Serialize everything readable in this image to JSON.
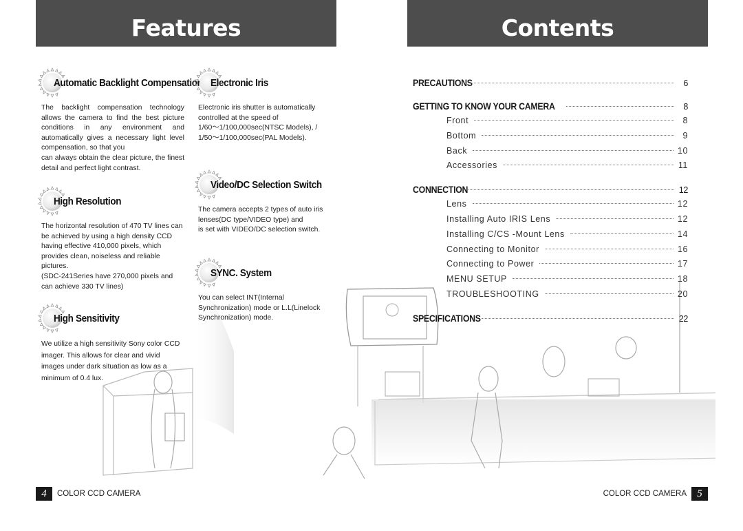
{
  "left_page": {
    "title": "Features",
    "features": [
      {
        "title": "Automatic Backlight Compensation",
        "body": [
          "The backlight compensation technology allows the camera to find the best picture conditions in any environment and automatically gives a necessary light level compensation, so that you",
          "can always obtain the clear picture, the finest detail and perfect light contrast."
        ]
      },
      {
        "title": "Electronic Iris",
        "body": [
          "Electronic iris shutter is automatically controlled at the speed of",
          "1/60～1/100,000sec(NTSC Models), /",
          "1/50～1/100,000sec(PAL Models)."
        ]
      },
      {
        "title": "High Resolution",
        "body": [
          "The horizontal resolution of 470 TV lines can be achieved by using a high density CCD having effective 410,000 pixels, which provides clean, noiseless and reliable pictures.",
          "(SDC-241Series  have 270,000 pixels and can achieve 330 TV lines)"
        ]
      },
      {
        "title": "Video/DC Selection Switch",
        "body": [
          "The camera accepts 2 types of auto iris lenses(DC type/VIDEO type) and",
          "is set with VIDEO/DC selection switch."
        ]
      },
      {
        "title": "SYNC. System",
        "body": [
          "You can select INT(Internal",
          "Synchronization) mode or L.L(Linelock",
          "Synchronization) mode."
        ]
      },
      {
        "title": "High Sensitivity",
        "body": [
          "We utilize a high sensitivity Sony color CCD imager. This allows for clear and vivid images under dark situation as low as a minimum of 0.4 lux."
        ]
      }
    ],
    "footer": {
      "page_number": "4",
      "label": "COLOR CCD CAMERA"
    }
  },
  "right_page": {
    "title": "Contents",
    "toc": [
      {
        "level": "main",
        "label": "PRECAUTIONS",
        "page": "6"
      },
      {
        "level": "main",
        "label": "GETTING TO KNOW YOUR CAMERA",
        "page": "8"
      },
      {
        "level": "sub",
        "label": "Front",
        "page": "8"
      },
      {
        "level": "sub",
        "label": "Bottom",
        "page": "9"
      },
      {
        "level": "sub",
        "label": "Back",
        "page": "10"
      },
      {
        "level": "sub",
        "label": "Accessories",
        "page": "11"
      },
      {
        "level": "main",
        "label": "CONNECTION",
        "page": "12"
      },
      {
        "level": "sub",
        "label": "Lens",
        "page": "12"
      },
      {
        "level": "sub",
        "label": "Installing Auto IRIS Lens",
        "page": "12"
      },
      {
        "level": "sub",
        "label": "Installing C/CS -Mount Lens",
        "page": "14"
      },
      {
        "level": "sub",
        "label": "Connecting to Monitor",
        "page": "16"
      },
      {
        "level": "sub",
        "label": "Connecting to Power",
        "page": "17"
      },
      {
        "level": "sub",
        "label": "MENU SETUP",
        "page": "18"
      },
      {
        "level": "sub",
        "label": "TROUBLESHOOTING",
        "page": "20"
      },
      {
        "level": "main",
        "label": "SPECIFICATIONS",
        "page": "22"
      }
    ],
    "footer": {
      "page_number": "5",
      "label": "COLOR CCD CAMERA"
    }
  },
  "icons": {
    "feature_bullet": "sun-burst-icon"
  },
  "colors": {
    "banner_bg": "#4d4d4d",
    "banner_text": "#ffffff",
    "page_box_bg": "#1a1a1a"
  }
}
